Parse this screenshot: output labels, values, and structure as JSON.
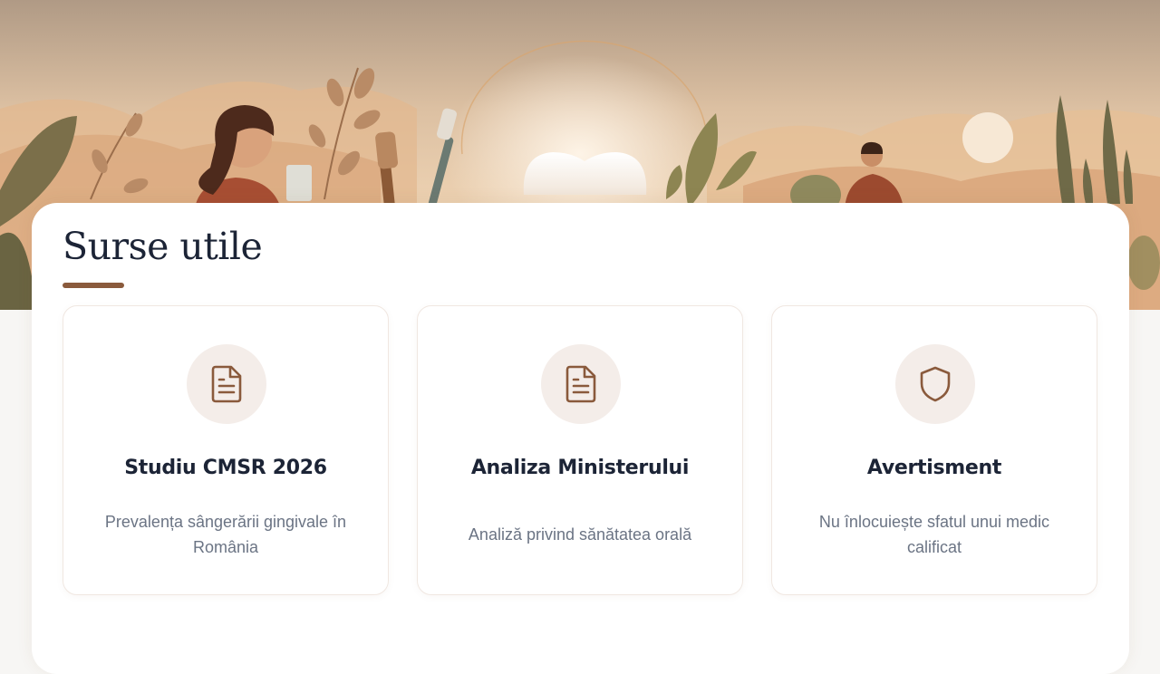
{
  "section": {
    "title": "Surse utile"
  },
  "cards": [
    {
      "icon": "document-icon",
      "title": "Studiu CMSR 2026",
      "description": "Prevalența sângerării gingivale în România"
    },
    {
      "icon": "document-icon",
      "title": "Analiza Ministerului",
      "description": "Analiză privind sănătatea orală"
    },
    {
      "icon": "shield-icon",
      "title": "Avertisment",
      "description": "Nu înlocuiește sfatul unui medic calificat"
    }
  ],
  "colors": {
    "accent": "#8a5a3c",
    "title": "#1c2436",
    "muted_text": "#6b7484",
    "icon_bg": "#f4ede9",
    "hero_sky": "#e8c9a4"
  }
}
